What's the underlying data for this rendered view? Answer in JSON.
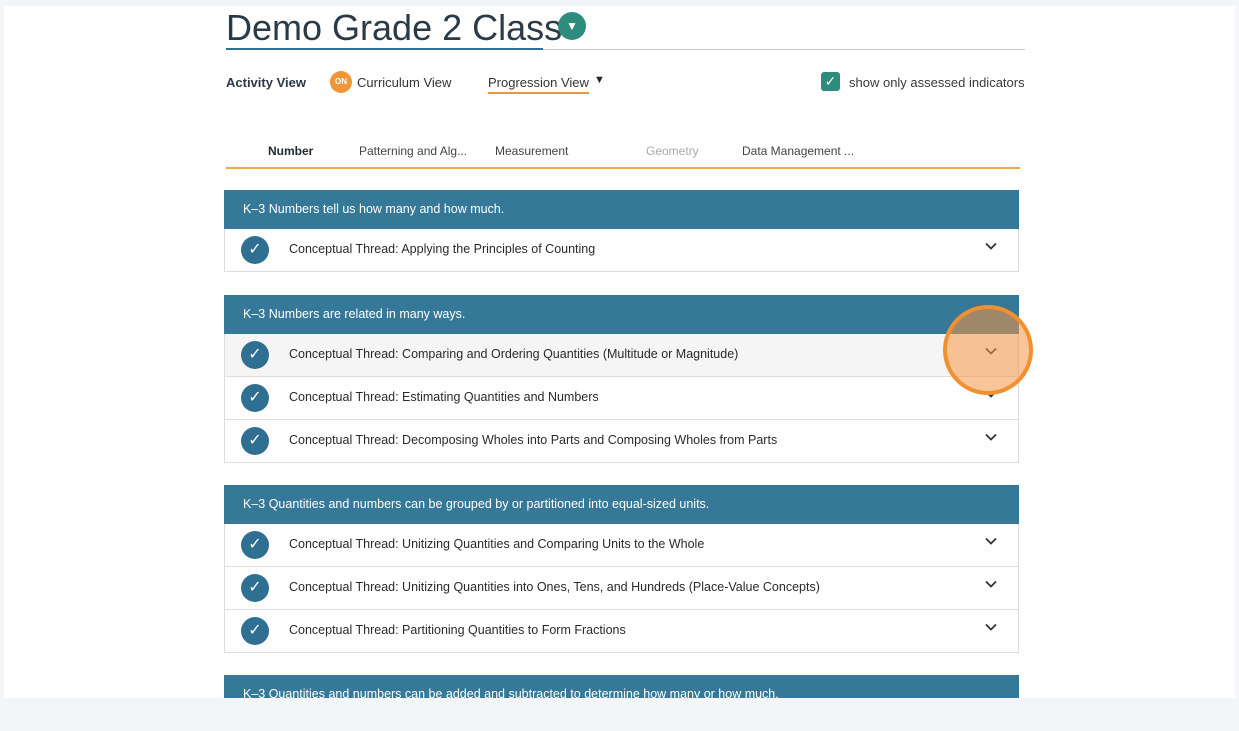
{
  "page": {
    "title": "Demo Grade 2 Class",
    "title_dropdown_glyph": "▼"
  },
  "view_bar": {
    "activity_view": "Activity View",
    "toggle_badge": "ON",
    "curriculum_view": "Curriculum View",
    "progression_view": "Progression View",
    "progression_arrow": "▼",
    "assessed_checked": true,
    "assessed_check_glyph": "✓",
    "assessed_label": "show only assessed indicators"
  },
  "tabs": [
    {
      "label": "Number",
      "state": "active"
    },
    {
      "label": "Patterning and Alg...",
      "state": "normal"
    },
    {
      "label": "Measurement",
      "state": "normal"
    },
    {
      "label": "Geometry",
      "state": "disabled"
    },
    {
      "label": "Data Management ...",
      "state": "normal"
    }
  ],
  "check_glyph": "✓",
  "sections": [
    {
      "heading": "K–3 Numbers tell us how many and how much.",
      "threads": [
        {
          "label": "Conceptual Thread: Applying the Principles of Counting"
        }
      ]
    },
    {
      "heading": "K–3 Numbers are related in many ways.",
      "threads": [
        {
          "label": "Conceptual Thread: Comparing and Ordering Quantities (Multitude or Magnitude)"
        },
        {
          "label": "Conceptual Thread: Estimating Quantities and Numbers"
        },
        {
          "label": "Conceptual Thread: Decomposing Wholes into Parts and Composing Wholes from Parts"
        }
      ]
    },
    {
      "heading": "K–3 Quantities and numbers can be grouped by or partitioned into equal-sized units.",
      "threads": [
        {
          "label": "Conceptual Thread: Unitizing Quantities and Comparing Units to the Whole"
        },
        {
          "label": "Conceptual Thread: Unitizing Quantities into Ones, Tens, and Hundreds (Place-Value Concepts)"
        },
        {
          "label": "Conceptual Thread: Partitioning Quantities to Form Fractions"
        }
      ]
    },
    {
      "heading": "K–3 Quantities and numbers can be added and subtracted to determine how many or how much.",
      "threads": []
    }
  ],
  "colors": {
    "section_header": "#357897",
    "accent_orange": "#f0953a",
    "check_blue": "#2f6f92",
    "teal": "#2e8c7d"
  }
}
